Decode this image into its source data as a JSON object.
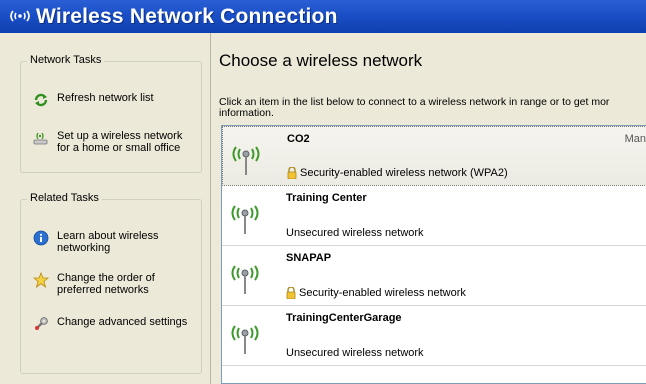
{
  "window": {
    "title": "Wireless Network Connection"
  },
  "network_tasks": {
    "title": "Network Tasks",
    "items": [
      {
        "label": "Refresh network list",
        "icon": "refresh-icon"
      },
      {
        "label": "Set up a wireless network for a home or small office",
        "icon": "setup-network-icon"
      }
    ]
  },
  "related_tasks": {
    "title": "Related Tasks",
    "items": [
      {
        "label": "Learn about wireless networking",
        "icon": "info-icon"
      },
      {
        "label": "Change the order of preferred networks",
        "icon": "star-icon"
      },
      {
        "label": "Change advanced settings",
        "icon": "settings-icon"
      }
    ]
  },
  "main": {
    "heading": "Choose a wireless network",
    "instructions_line1": "Click an item in the list below to connect to a wireless network in range or to get mor",
    "instructions_line2": "information."
  },
  "networks": [
    {
      "name": "CO2",
      "mode": "Man",
      "security": "Security-enabled wireless network (WPA2)",
      "locked": true
    },
    {
      "name": "Training Center",
      "mode": "",
      "security": "Unsecured wireless network",
      "locked": false
    },
    {
      "name": "SNAPAP",
      "mode": "",
      "security": "Security-enabled wireless network",
      "locked": true
    },
    {
      "name": "TrainingCenterGarage",
      "mode": "",
      "security": "Unsecured wireless network",
      "locked": false
    }
  ],
  "colors": {
    "titlebar": "#1b4fc6",
    "pane": "#ece9d8",
    "signal_green": "#3f9a2e"
  }
}
